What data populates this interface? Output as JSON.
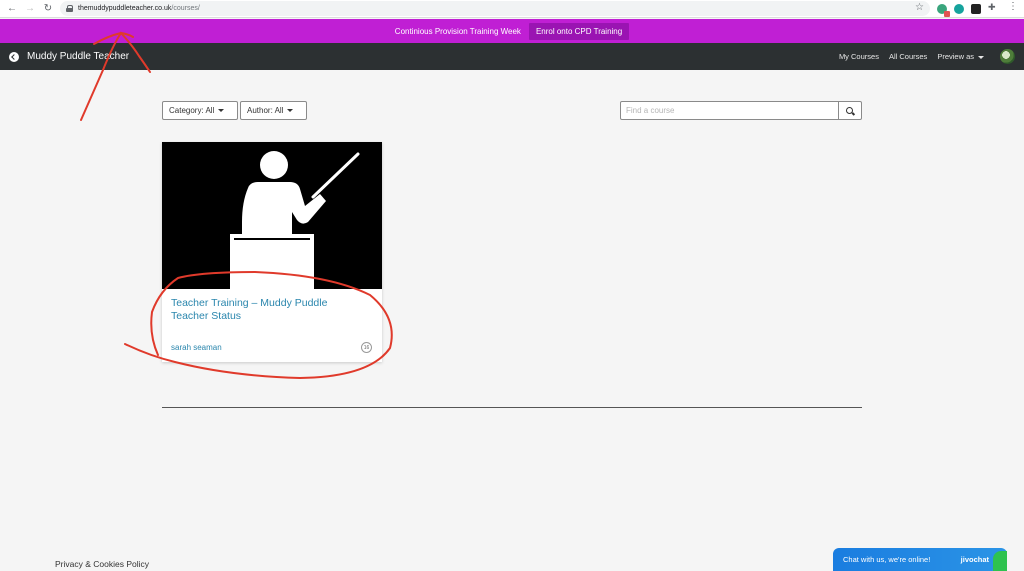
{
  "browser": {
    "url_host": "themuddypuddleteacher.co.uk",
    "url_path": "/courses/"
  },
  "promo": {
    "text": "Continious Provision Training Week",
    "button": "Enrol onto CPD Training"
  },
  "header": {
    "title": "Muddy Puddle Teacher",
    "links": [
      "My Courses",
      "All Courses",
      "Preview as"
    ]
  },
  "filters": {
    "category": "Category: All",
    "author": "Author: All"
  },
  "search": {
    "placeholder": "Find a course"
  },
  "course": {
    "title": "Teacher Training – Muddy Puddle Teacher Status",
    "author": "sarah seaman",
    "lesson_count": "16"
  },
  "footer": {
    "privacy": "Privacy & Cookies Policy"
  },
  "chat": {
    "text": "Chat with us, we're online!",
    "brand": "jivochat"
  },
  "colors": {
    "promo_bg": "#c01fd4",
    "header_bg": "#2c3032",
    "link": "#2a86ad",
    "annotation": "#e03a2b"
  }
}
